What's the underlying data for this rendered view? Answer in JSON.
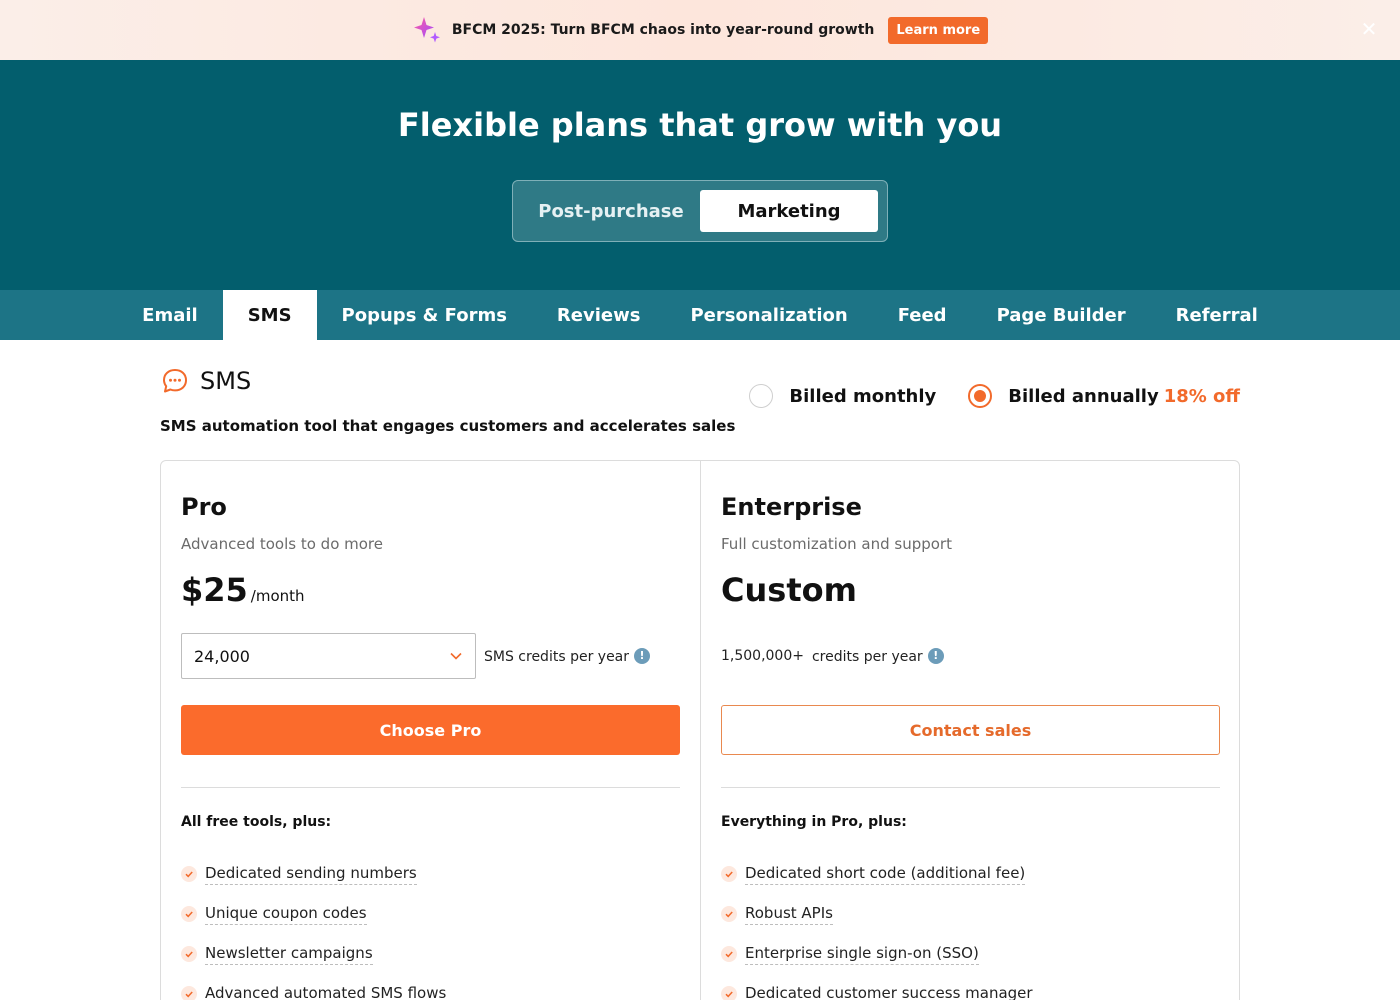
{
  "promo": {
    "text": "BFCM 2025: Turn BFCM chaos into year-round growth",
    "button_label": "Learn more",
    "close_glyph": "✕",
    "icon": "sparkle-icon"
  },
  "hero": {
    "title": "Flexible plans that grow with you",
    "switch": [
      {
        "label": "Post-purchase",
        "active": false
      },
      {
        "label": "Marketing",
        "active": true
      }
    ]
  },
  "tabs": [
    {
      "label": "Email",
      "active": false
    },
    {
      "label": "SMS",
      "active": true
    },
    {
      "label": "Popups & Forms",
      "active": false
    },
    {
      "label": "Reviews",
      "active": false
    },
    {
      "label": "Personalization",
      "active": false
    },
    {
      "label": "Feed",
      "active": false
    },
    {
      "label": "Page Builder",
      "active": false
    },
    {
      "label": "Referral",
      "active": false
    }
  ],
  "product": {
    "title": "SMS",
    "icon": "chat-bubble-icon",
    "description": "SMS automation tool that engages customers and accelerates sales"
  },
  "billing": {
    "monthly_label": "Billed monthly",
    "annually_label": "Billed annually",
    "discount": "18% off",
    "selected": "annually"
  },
  "plans": {
    "pro": {
      "name": "Pro",
      "subtitle": "Advanced tools to do more",
      "price": "$25",
      "per": "/month",
      "credits_value": "24,000",
      "credits_label": "SMS credits per year",
      "cta": "Choose Pro",
      "features_heading": "All free tools, plus:",
      "features": [
        "Dedicated sending numbers",
        "Unique coupon codes",
        "Newsletter campaigns",
        "Advanced automated SMS flows"
      ]
    },
    "enterprise": {
      "name": "Enterprise",
      "subtitle": "Full customization and support",
      "price": "Custom",
      "credits_value": "1,500,000+",
      "credits_label": "credits per year",
      "cta": "Contact sales",
      "features_heading": "Everything in Pro, plus:",
      "features": [
        "Dedicated short code (additional fee)",
        "Robust APIs",
        "Enterprise single sign-on (SSO)",
        "Dedicated customer success manager"
      ]
    }
  },
  "info_glyph": "!",
  "colors": {
    "accent": "#f26a2b",
    "hero_bg": "#035e6d",
    "tabbar_bg": "#1d7486",
    "info": "#6c9cb9"
  }
}
